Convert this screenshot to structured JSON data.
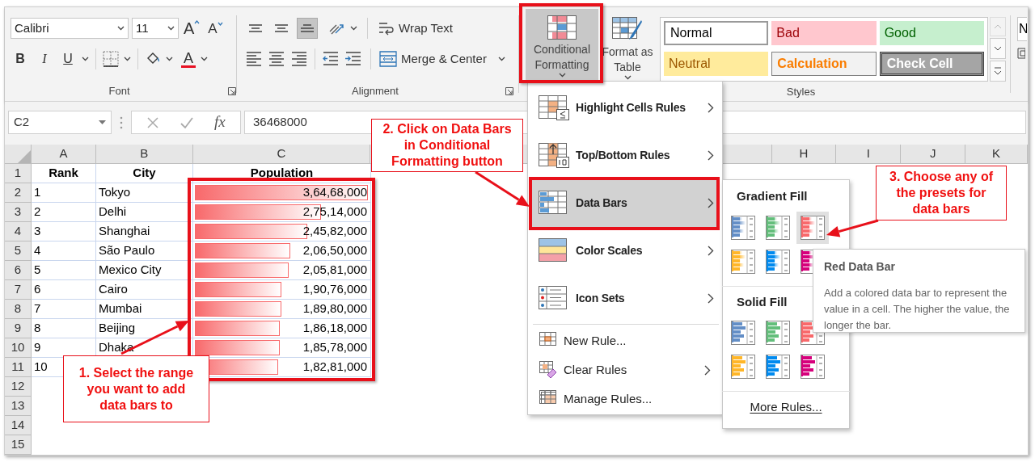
{
  "ribbon": {
    "font_group": {
      "label": "Font",
      "font_name": "Calibri",
      "font_size": "11",
      "grow_font": "A",
      "shrink_font": "A",
      "bold": "B",
      "italic": "I",
      "underline": "U",
      "font_color": "A"
    },
    "alignment_group": {
      "label": "Alignment",
      "vertical_alignment": [
        {
          "kind": "top",
          "selected": false
        },
        {
          "kind": "middle",
          "selected": false
        },
        {
          "kind": "bottom",
          "selected": true
        }
      ],
      "wrap_text": "Wrap Text",
      "merge_center": "Merge & Center"
    },
    "styles_group": {
      "label": "Styles",
      "conditional_formatting": {
        "label": "Conditional Formatting",
        "selected": true
      },
      "format_as_table": "Format as Table",
      "cell_styles": [
        {
          "label": "Normal",
          "kind": "normal"
        },
        {
          "label": "Bad",
          "kind": "bad"
        },
        {
          "label": "Good",
          "kind": "good"
        },
        {
          "label": "Neutral",
          "kind": "neutral"
        },
        {
          "label": "Calculation",
          "kind": "calculation"
        },
        {
          "label": "Check Cell",
          "kind": "check"
        }
      ]
    },
    "next_group": {
      "partial_label": "N"
    }
  },
  "formula_bar": {
    "name_box": "C2",
    "function_button": "fx",
    "formula": "36468000"
  },
  "sheet": {
    "columns": [
      "A",
      "B",
      "C",
      "H",
      "I",
      "J",
      "K"
    ],
    "row_numbers": [
      "1",
      "2",
      "3",
      "4",
      "5",
      "6",
      "7",
      "8",
      "9",
      "10",
      "11",
      "12",
      "13",
      "14",
      "15"
    ],
    "header": [
      "Rank",
      "City",
      "Population"
    ],
    "rows": [
      {
        "rank": "1",
        "city": "Tokyo",
        "population": "3,64,68,000",
        "level": 1.0
      },
      {
        "rank": "2",
        "city": "Delhi",
        "population": "2,75,14,000",
        "level": 0.73
      },
      {
        "rank": "3",
        "city": "Shanghai",
        "population": "2,45,82,000",
        "level": 0.65
      },
      {
        "rank": "4",
        "city": "São Paulo",
        "population": "2,06,50,000",
        "level": 0.55
      },
      {
        "rank": "5",
        "city": "Mexico City",
        "population": "2,05,81,000",
        "level": 0.54
      },
      {
        "rank": "6",
        "city": "Cairo",
        "population": "1,90,76,000",
        "level": 0.5
      },
      {
        "rank": "7",
        "city": "Mumbai",
        "population": "1,89,80,000",
        "level": 0.5
      },
      {
        "rank": "8",
        "city": "Beijing",
        "population": "1,86,18,000",
        "level": 0.49
      },
      {
        "rank": "9",
        "city": "Dhaka",
        "population": "1,85,78,000",
        "level": 0.49
      },
      {
        "rank": "10",
        "population": "1,82,81,000",
        "level": 0.48
      }
    ]
  },
  "conditional_formatting_menu": {
    "items": [
      {
        "label": "Highlight Cells Rules",
        "kind": "highlight",
        "selected": false
      },
      {
        "label": "Top/Bottom Rules",
        "kind": "topbottom",
        "selected": false
      },
      {
        "label": "Data Bars",
        "kind": "databars",
        "selected": true
      },
      {
        "label": "Color Scales",
        "kind": "colorscales",
        "selected": false
      },
      {
        "label": "Icon Sets",
        "kind": "iconsets",
        "selected": false
      }
    ],
    "rule_items": [
      {
        "label": "New Rule...",
        "kind": "newrule",
        "submenu": false
      },
      {
        "label": "Clear Rules",
        "kind": "clear",
        "submenu": true
      },
      {
        "label": "Manage Rules...",
        "kind": "manage",
        "submenu": false
      }
    ]
  },
  "data_bars_submenu": {
    "sections": [
      {
        "title": "Gradient Fill",
        "kind": "gradient",
        "presets": [
          {
            "color": "#638ec6",
            "selected": false
          },
          {
            "color": "#63be7b",
            "selected": false
          },
          {
            "color": "#f8696b",
            "selected": true
          },
          {
            "color": "#ffb628",
            "selected": false
          },
          {
            "color": "#008aef",
            "selected": false
          },
          {
            "color": "#d6007b",
            "selected": false
          }
        ]
      },
      {
        "title": "Solid Fill",
        "kind": "solid",
        "presets": [
          {
            "color": "#638ec6",
            "selected": false
          },
          {
            "color": "#63be7b",
            "selected": false
          },
          {
            "color": "#f8696b",
            "selected": false
          },
          {
            "color": "#ffb628",
            "selected": false
          },
          {
            "color": "#008aef",
            "selected": false
          },
          {
            "color": "#d6007b",
            "selected": false
          }
        ]
      }
    ],
    "more": "More Rules..."
  },
  "tooltip": {
    "title": "Red Data Bar",
    "text": "Add a colored data bar to represent the value in a cell. The higher the value, the longer the bar."
  },
  "annotations": [
    {
      "text": "1. Select the range\nyou want to add\ndata bars to"
    },
    {
      "text": "2. Click on Data Bars\nin Conditional\nFormatting button"
    },
    {
      "text": "3. Choose any of\nthe presets for\ndata bars"
    }
  ]
}
